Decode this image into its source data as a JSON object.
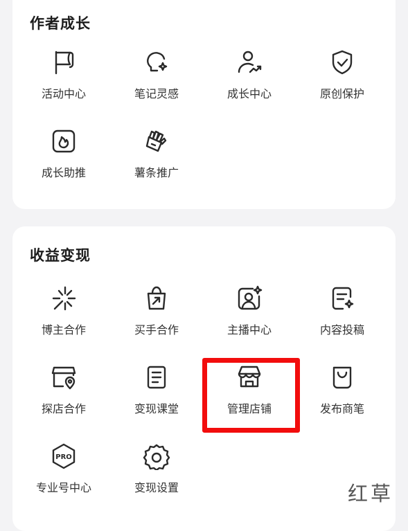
{
  "growth": {
    "title": "作者成长",
    "items": [
      {
        "label": "活动中心",
        "icon": "flag-icon"
      },
      {
        "label": "笔记灵感",
        "icon": "lightbulb-icon"
      },
      {
        "label": "成长中心",
        "icon": "user-growth-icon"
      },
      {
        "label": "原创保护",
        "icon": "shield-check-icon"
      },
      {
        "label": "成长助推",
        "icon": "flame-icon"
      },
      {
        "label": "薯条推广",
        "icon": "fries-icon"
      }
    ]
  },
  "earn": {
    "title": "收益变现",
    "items": [
      {
        "label": "博主合作",
        "icon": "sparkle-burst-icon"
      },
      {
        "label": "买手合作",
        "icon": "shopping-bag-arrow-icon"
      },
      {
        "label": "主播中心",
        "icon": "portrait-star-icon"
      },
      {
        "label": "内容投稿",
        "icon": "document-sparkle-icon"
      },
      {
        "label": "探店合作",
        "icon": "store-location-icon"
      },
      {
        "label": "变现课堂",
        "icon": "notebook-icon"
      },
      {
        "label": "管理店铺",
        "icon": "storefront-icon"
      },
      {
        "label": "发布商笔",
        "icon": "tote-bag-icon"
      },
      {
        "label": "专业号中心",
        "icon": "pro-badge-icon"
      },
      {
        "label": "变现设置",
        "icon": "gear-icon"
      }
    ]
  },
  "highlight_color": "#f20d0d",
  "watermark": "红草"
}
